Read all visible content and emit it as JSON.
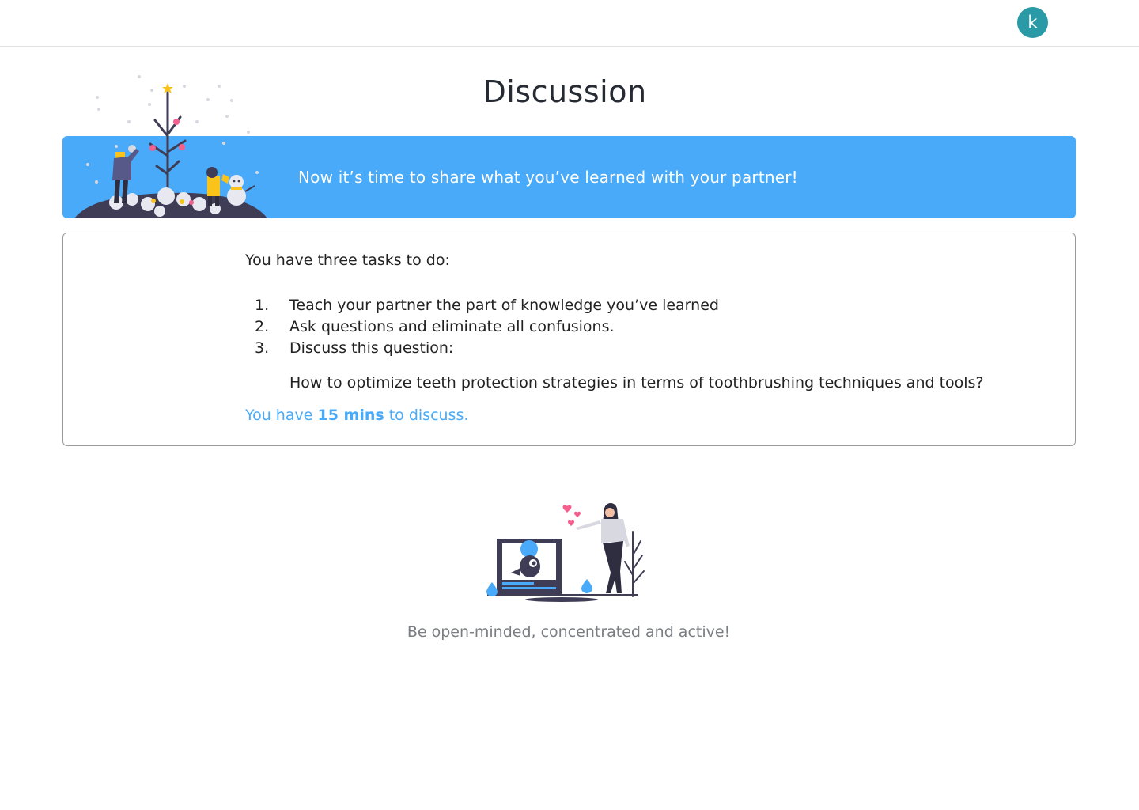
{
  "header": {
    "avatar_initial": "k"
  },
  "page": {
    "title": "Discussion"
  },
  "banner": {
    "text": "Now it’s time to share what you’ve learned with your partner!",
    "background_color": "#48aaf8"
  },
  "tasks": {
    "intro": "You have three tasks to do:",
    "items": [
      {
        "number": "1.",
        "text": "Teach your partner the part of knowledge you’ve learned"
      },
      {
        "number": "2.",
        "text": "Ask questions and eliminate all confusions."
      },
      {
        "number": "3.",
        "text": "Discuss this question:"
      }
    ],
    "question": "How to optimize teeth protection strategies in terms of toothbrushing techniques and tools?",
    "time_prefix": "You have",
    "time_value": "15 mins",
    "time_suffix": "to discuss."
  },
  "footer": {
    "note": "Be open-minded, concentrated and active!"
  },
  "colors": {
    "accent": "#48aaf8",
    "avatar": "#2a9aa6",
    "illustration_dark": "#3f3d56"
  },
  "icons": {
    "winter_illustration": "winter-scene-illustration",
    "discussion_illustration": "video-call-illustration"
  }
}
